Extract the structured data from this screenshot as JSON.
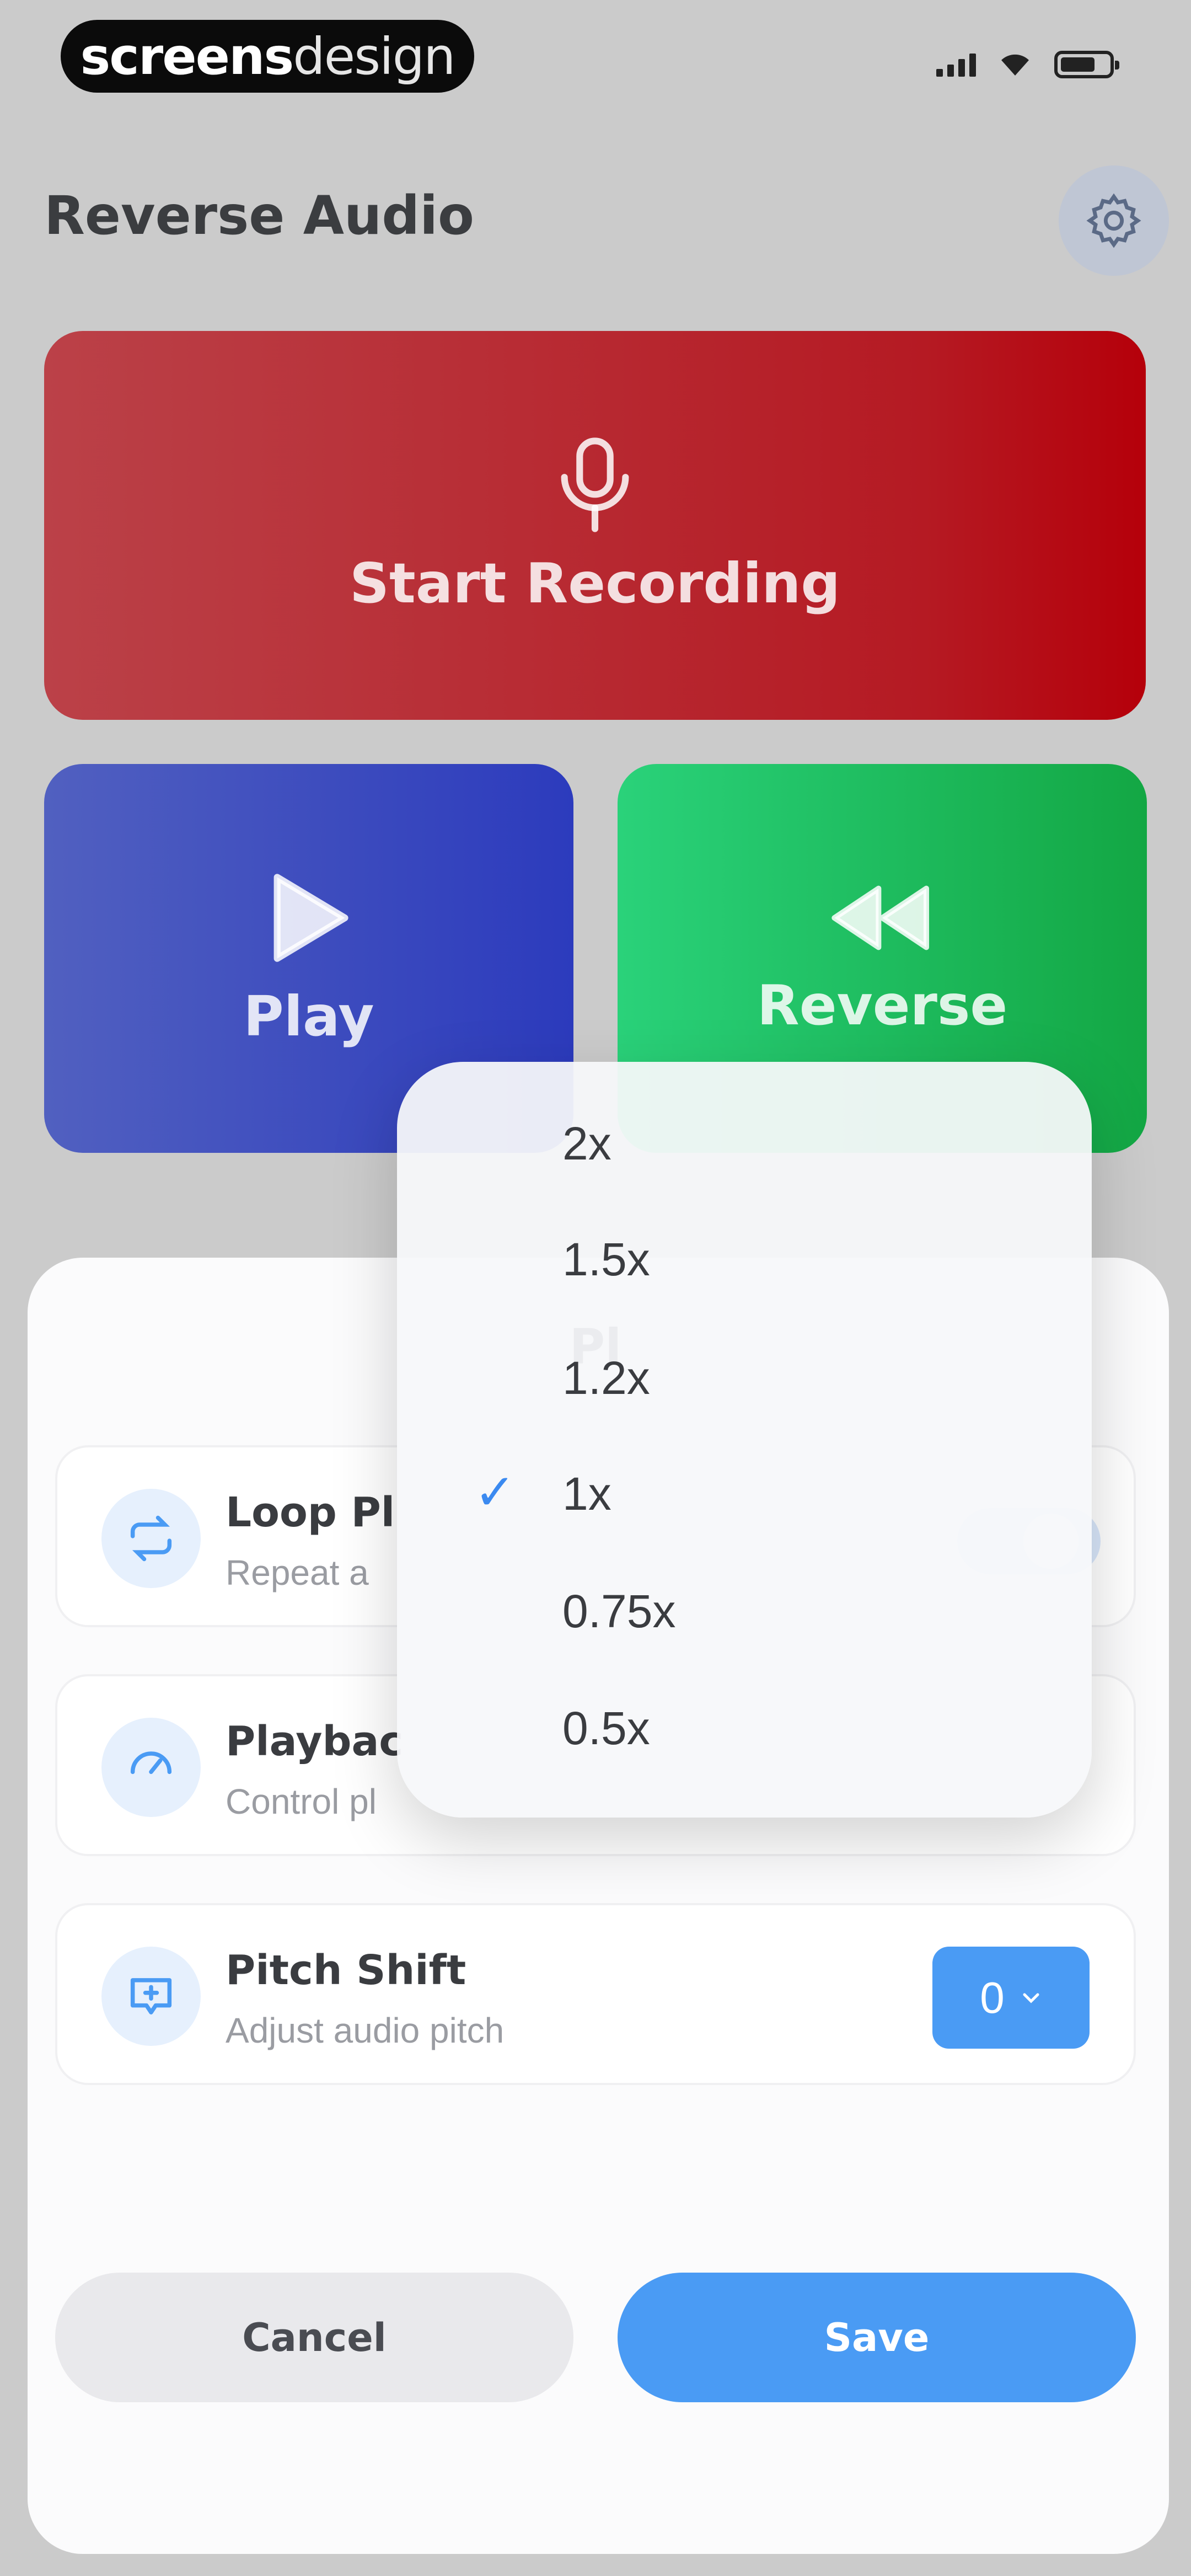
{
  "status_bar": {
    "brand": "screensdesign",
    "brand_bold": "screens",
    "brand_thin": "design"
  },
  "header": {
    "title": "Reverse Audio",
    "settings_icon": "gear-icon"
  },
  "actions": {
    "record_label": "Start Recording",
    "record_icon": "microphone-icon",
    "play_label": "Play",
    "play_icon": "play-icon",
    "reverse_label": "Reverse",
    "reverse_icon": "rewind-icon"
  },
  "sheet": {
    "title": "Pl",
    "settings": [
      {
        "name": "Loop Pl",
        "description": "Repeat a",
        "icon": "loop-icon",
        "control": "toggle",
        "on": true
      },
      {
        "name": "Playbac",
        "description": "Control pl",
        "icon": "speed-icon",
        "control": "menu"
      },
      {
        "name": "Pitch Shift",
        "description": "Adjust audio pitch",
        "icon": "pitch-icon",
        "control": "select",
        "value": "0"
      }
    ],
    "cancel_label": "Cancel",
    "save_label": "Save"
  },
  "speed_menu": {
    "options": [
      "2x",
      "1.5x",
      "1.2x",
      "1x",
      "0.75x",
      "0.5x"
    ],
    "selected": "1x",
    "check_glyph": "✓"
  },
  "colors": {
    "record": "#b51a23",
    "play": "#2c3bbd",
    "reverse": "#13a744",
    "accent": "#4a9bf4"
  }
}
